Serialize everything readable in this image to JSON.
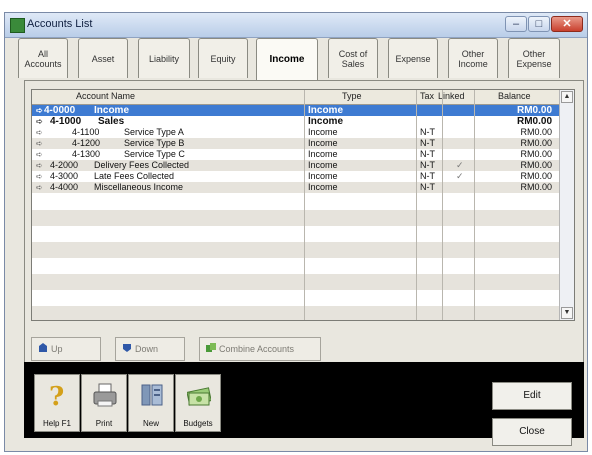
{
  "window": {
    "title": "Accounts List"
  },
  "tabs": [
    {
      "label": "All Accounts"
    },
    {
      "label": "Asset"
    },
    {
      "label": "Liability"
    },
    {
      "label": "Equity"
    },
    {
      "label": "Income"
    },
    {
      "label": "Cost of Sales"
    },
    {
      "label": "Expense"
    },
    {
      "label": "Other Income"
    },
    {
      "label": "Other Expense"
    }
  ],
  "grid": {
    "headers": {
      "account_name": "Account Name",
      "type": "Type",
      "tax": "Tax",
      "linked": "Linked",
      "balance": "Balance"
    },
    "rows": [
      {
        "number": "4-0000",
        "name": "Income",
        "type": "Income",
        "tax": "",
        "linked": "",
        "balance": "RM0.00"
      },
      {
        "number": "4-1000",
        "name": "Sales",
        "type": "Income",
        "tax": "",
        "linked": "",
        "balance": "RM0.00"
      },
      {
        "number": "4-1100",
        "name": "Service Type A",
        "type": "Income",
        "tax": "N-T",
        "linked": "",
        "balance": "RM0.00"
      },
      {
        "number": "4-1200",
        "name": "Service Type B",
        "type": "Income",
        "tax": "N-T",
        "linked": "",
        "balance": "RM0.00"
      },
      {
        "number": "4-1300",
        "name": "Service Type C",
        "type": "Income",
        "tax": "N-T",
        "linked": "",
        "balance": "RM0.00"
      },
      {
        "number": "4-2000",
        "name": "Delivery Fees Collected",
        "type": "Income",
        "tax": "N-T",
        "linked": "✓",
        "balance": "RM0.00"
      },
      {
        "number": "4-3000",
        "name": "Late Fees Collected",
        "type": "Income",
        "tax": "N-T",
        "linked": "✓",
        "balance": "RM0.00"
      },
      {
        "number": "4-4000",
        "name": "Miscellaneous Income",
        "type": "Income",
        "tax": "N-T",
        "linked": "",
        "balance": "RM0.00"
      }
    ]
  },
  "panel_buttons": {
    "up": "Up",
    "down": "Down",
    "combine": "Combine Accounts"
  },
  "toolbar": {
    "help": "Help F1",
    "print": "Print",
    "new": "New",
    "budgets": "Budgets"
  },
  "actions": {
    "edit": "Edit",
    "close": "Close"
  },
  "icons": {
    "app": "accounts-list-icon",
    "help": "help-icon",
    "print": "printer-icon",
    "new": "new-icon",
    "budgets": "budgets-icon"
  },
  "colors": {
    "selection": "#3e7bd2",
    "close_button": "#c9402e"
  }
}
